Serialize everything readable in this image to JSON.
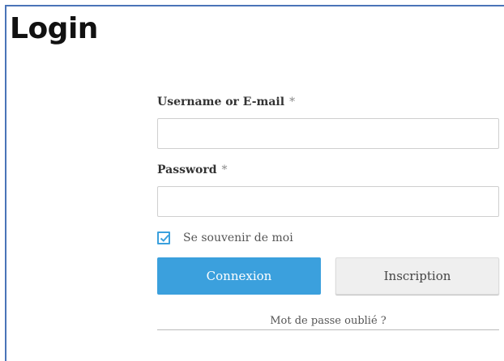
{
  "page": {
    "title": "Login"
  },
  "form": {
    "username": {
      "label": "Username or E-mail",
      "required_marker": "*",
      "value": "",
      "placeholder": ""
    },
    "password": {
      "label": "Password",
      "required_marker": "*",
      "value": "",
      "placeholder": ""
    },
    "remember": {
      "label": "Se souvenir de moi",
      "checked": true
    },
    "buttons": {
      "login_label": "Connexion",
      "register_label": "Inscription"
    },
    "forgot_password_label": "Mot de passe oublié ?"
  },
  "colors": {
    "primary": "#3ba0dd",
    "frame_border": "#4a74b8",
    "secondary_button": "#efefef"
  },
  "icons": {
    "remember_checkbox": "checkmark-icon"
  }
}
